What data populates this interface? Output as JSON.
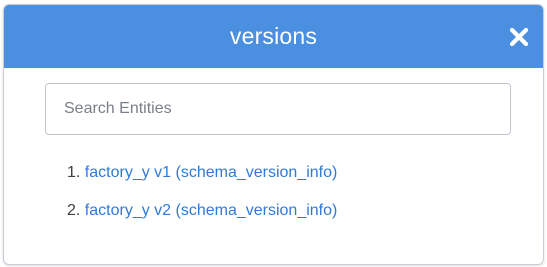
{
  "dialog": {
    "title": "versions",
    "close_icon": "close-icon"
  },
  "search": {
    "placeholder": "Search Entities",
    "value": ""
  },
  "versions": [
    {
      "number": "1.",
      "label": "factory_y v1 (schema_version_info)"
    },
    {
      "number": "2.",
      "label": "factory_y v2 (schema_version_info)"
    }
  ],
  "colors": {
    "header_bg": "#4a8fe0",
    "link": "#2f7ad6"
  }
}
